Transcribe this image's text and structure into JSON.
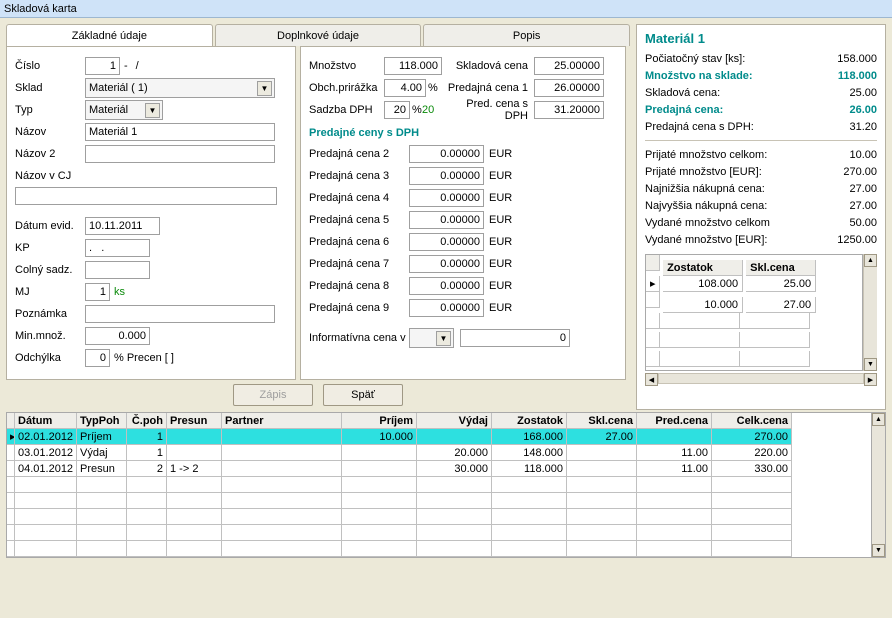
{
  "window": {
    "title": "Skladová karta"
  },
  "tabs": {
    "t1": "Základné údaje",
    "t2": "Doplnkové údaje",
    "t3": "Popis"
  },
  "left": {
    "cislo_lbl": "Číslo",
    "cislo_a": "1",
    "cislo_sep": "-",
    "cislo_b": "/",
    "sklad_lbl": "Sklad",
    "sklad_val": "Materiál ( 1)",
    "typ_lbl": "Typ",
    "typ_val": "Materiál",
    "nazov_lbl": "Názov",
    "nazov_val": "Materiál 1",
    "nazov2_lbl": "Názov 2",
    "nazovcj_lbl": "Názov v CJ",
    "datum_lbl": "Dátum evid.",
    "datum_val": "10.11.2011",
    "kp_lbl": "KP",
    "kp_val": ".   .",
    "colny_lbl": "Colný sadz.",
    "mj_lbl": "MJ",
    "mj_val": "1",
    "mj_unit": "ks",
    "pozn_lbl": "Poznámka",
    "minm_lbl": "Min.množ.",
    "minm_val": "0.000",
    "odch_lbl": "Odchýlka",
    "odch_val": "0",
    "odch_suffix": "% Precen [      ]"
  },
  "mid": {
    "mnoz_lbl": "Množstvo",
    "mnoz_val": "118.000",
    "skc_lbl": "Skladová cena",
    "skc_val": "25.00000",
    "obch_lbl": "Obch.prirážka",
    "obch_val": "4.00",
    "pct": "%",
    "pc1_lbl": "Predajná cena 1",
    "pc1_val": "26.00000",
    "dph_lbl": "Sadzba DPH",
    "dph_val": "20",
    "dph_sfx": "%",
    "dph_copy": "20",
    "pcdph_lbl": "Pred. cena s DPH",
    "pcdph_val": "31.20000",
    "section": "Predajné ceny s DPH",
    "p2l": "Predajná cena 2",
    "p2v": "0.00000",
    "cur": "EUR",
    "p3l": "Predajná cena 3",
    "p3v": "0.00000",
    "p4l": "Predajná cena 4",
    "p4v": "0.00000",
    "p5l": "Predajná cena 5",
    "p5v": "0.00000",
    "p6l": "Predajná cena 6",
    "p6v": "0.00000",
    "p7l": "Predajná cena 7",
    "p7v": "0.00000",
    "p8l": "Predajná cena 8",
    "p8v": "0.00000",
    "p9l": "Predajná cena 9",
    "p9v": "0.00000",
    "infc_lbl": "Informatívna cena v",
    "infc_val": "0"
  },
  "right": {
    "title": "Materiál 1",
    "r1l": "Počiatočný stav [ks]:",
    "r1v": "158.000",
    "r2l": "Množstvo na sklade:",
    "r2v": "118.000",
    "r3l": "Skladová cena:",
    "r3v": "25.00",
    "r4l": "Predajná cena:",
    "r4v": "26.00",
    "r5l": "Predajná cena s DPH:",
    "r5v": "31.20",
    "r6l": "Prijaté množstvo celkom:",
    "r6v": "10.00",
    "r7l": "Prijaté množstvo [EUR]:",
    "r7v": "270.00",
    "r8l": "Najnižšia nákupná cena:",
    "r8v": "27.00",
    "r9l": "Najvyššia nákupná cena:",
    "r9v": "27.00",
    "r10l": "Vydané množstvo celkom",
    "r10v": "50.00",
    "r11l": "Vydané množstvo [EUR]:",
    "r11v": "1250.00",
    "th1": "Zostatok",
    "th2": "Skl.cena",
    "t1a": "108.000",
    "t1b": "25.00",
    "t2a": "10.000",
    "t2b": "27.00"
  },
  "buttons": {
    "zapis": "Zápis",
    "spat": "Späť"
  },
  "grid": {
    "h_datum": "Dátum",
    "h_typ": "TypPoh",
    "h_cpoh": "Č.poh",
    "h_presun": "Presun",
    "h_partner": "Partner",
    "h_prijem": "Príjem",
    "h_vydaj": "Výdaj",
    "h_zost": "Zostatok",
    "h_skl": "Skl.cena",
    "h_pred": "Pred.cena",
    "h_celk": "Celk.cena",
    "rows": [
      {
        "d": "02.01.2012",
        "t": "Príjem",
        "c": "1",
        "pr": "",
        "pa": "",
        "pi": "10.000",
        "vy": "",
        "zo": "168.000",
        "sk": "27.00",
        "pc": "",
        "ck": "270.00"
      },
      {
        "d": "03.01.2012",
        "t": "Výdaj",
        "c": "1",
        "pr": "",
        "pa": "",
        "pi": "",
        "vy": "20.000",
        "zo": "148.000",
        "sk": "",
        "pc": "11.00",
        "ck": "220.00"
      },
      {
        "d": "04.01.2012",
        "t": "Presun",
        "c": "2",
        "pr": "1 -> 2",
        "pa": "",
        "pi": "",
        "vy": "30.000",
        "zo": "118.000",
        "sk": "",
        "pc": "11.00",
        "ck": "330.00"
      }
    ]
  }
}
